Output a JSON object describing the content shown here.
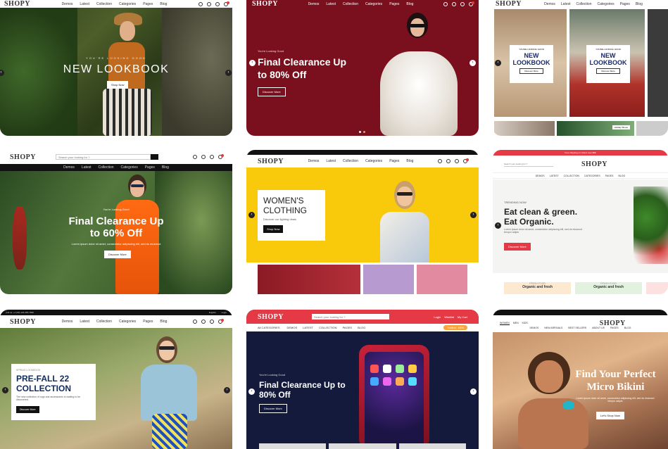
{
  "brand": "SHOPY",
  "colors": {
    "crimson": "#7a0f1d",
    "yellow": "#f9c90c",
    "red": "#e53945",
    "navy": "#131a3c",
    "green": "#1a3b22"
  },
  "icons": [
    "search-icon",
    "user-icon",
    "heart-icon",
    "cart-icon",
    "chevron-left-icon",
    "chevron-right-icon"
  ],
  "menu_a": [
    "Demos",
    "Latest",
    "Collection",
    "Categories",
    "Pages",
    "Blog"
  ],
  "menu_b": [
    "Demos",
    "Latest",
    "Collection",
    "Categories",
    "Pages",
    "Blog"
  ],
  "menu_c": [
    "DEMOS",
    "LATEST",
    "COLLECTION",
    "CATEGORIES",
    "PAGES",
    "BLOG"
  ],
  "menu_e": [
    "DEMOS",
    "NEW ARRIVALS",
    "BEST SELLERS",
    "ABOUT US",
    "PAGES",
    "BLOG"
  ],
  "search_placeholder": "Search your looking for ?",
  "cards": {
    "c1": {
      "kicker": "YOU'RE LOOKING GOOD",
      "title": "NEW LOOKBOOK",
      "btn": "Shop Now"
    },
    "c2": {
      "kicker": "You're Looking Good",
      "title1": "Final Clearance Up",
      "title2": "to 80% Off",
      "btn": "Discover More"
    },
    "c3": {
      "kicker": "YOU'RE LOOKING GOOD",
      "title1": "NEW",
      "title2": "LOOKBOOK",
      "btn": "Discover More",
      "badge": "Holiday Shoes"
    },
    "c4": {
      "kicker": "You're Looking Good",
      "title1": "Final Clearance Up",
      "title2": "to 60% Off",
      "desc": "Lorem ipsum dolor sit amet, consectetur adipiscing elit, sed do eiusmod",
      "btn": "Discover More"
    },
    "c5": {
      "title1": "WOMEN'S",
      "title2": "CLOTHING",
      "desc": "Discover our lighting deals",
      "btn": "Shop Now",
      "top": "Order status"
    },
    "c6": {
      "promo": "Free shipping on orders over $99",
      "kicker": "TRENDING NOW",
      "title1": "Eat clean & green.",
      "title2": "Eat Organic.",
      "desc": "Lorem ipsum dolor sit amet, consectetur adipiscing elit, sed do eiusmod tempor adipis",
      "btn": "Discover More",
      "tile1": "FRESH FOOD",
      "tile1b": "Organic and fresh",
      "tile2": "FRESH FOOD",
      "tile2b": "Organic and fresh"
    },
    "c7": {
      "topbar": "Call us: +1 (00) 123-456-7890",
      "kicker": "SPRING LOOKBOOK",
      "title1": "PRE-FALL 22",
      "title2": "COLLECTION",
      "desc": "The new collection of rugs and accessories is waiting to be discovered.",
      "btn": "Discover More",
      "lang": "English",
      "login": "Login"
    },
    "c8": {
      "kicker": "You're Looking Good",
      "title1": "Final Clearance Up to",
      "title2": "80% Off",
      "btn": "Discover More",
      "all": "All CATEGORIES",
      "hotline": "Hotline: 1900",
      "links": [
        "Login",
        "Wishlist",
        "My Cart"
      ]
    },
    "c9": {
      "tabs": [
        "WOMEN",
        "MEN",
        "KIDS"
      ],
      "title1": "Find Your Perfect",
      "title2": "Micro Bikini",
      "desc": "Lorem ipsum dolor sit amet, consectetur adipiscing elit, sed do eiusmod tempor adipis",
      "btn": "Let's Shop Now"
    }
  }
}
